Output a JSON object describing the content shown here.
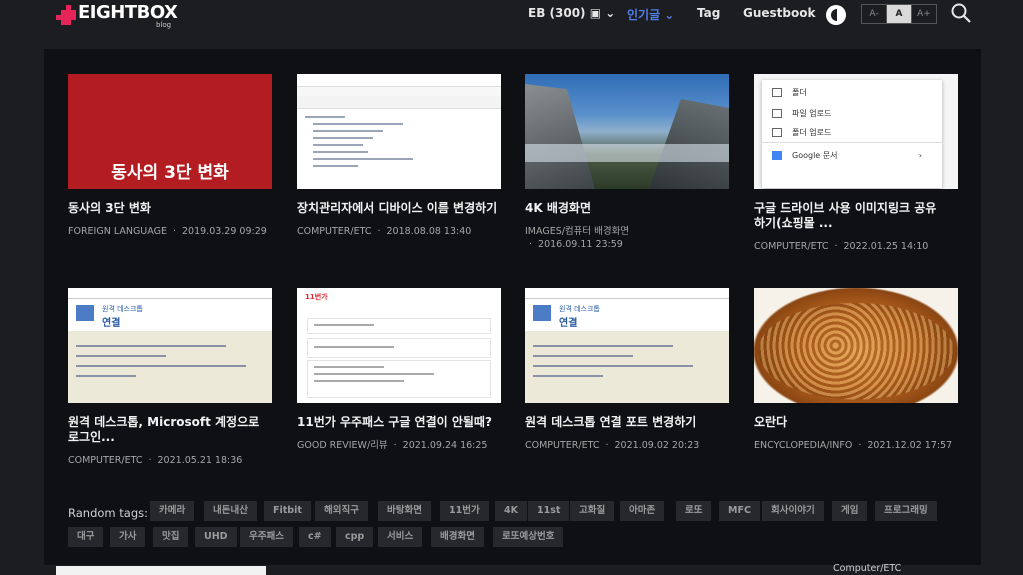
{
  "header": {
    "logo_text": "EIGHTBOX",
    "logo_sub": "blog",
    "nav": {
      "eb": "EB (300) ▣ ⌄",
      "popular": "인기글 ⌄",
      "tag": "Tag",
      "guestbook": "Guestbook"
    },
    "font_sizes": [
      "A-",
      "A",
      "A+"
    ],
    "active_font_index": 1,
    "accent_color": "#4f7fe8",
    "brand_color": "#e5245a"
  },
  "posts": [
    {
      "title": "동사의 3단 변화",
      "category": "FOREIGN LANGUAGE",
      "date": "2019.03.29 09:29",
      "thumb_text": "동사의 3단 변화"
    },
    {
      "title": "장치관리자에서 디바이스 이름 변경하기",
      "category": "COMPUTER/ETC",
      "date": "2018.08.08 13:40"
    },
    {
      "title": "4K 배경화면",
      "category": "IMAGES/컴퓨터 배경화면",
      "date": "2016.09.11 23:59"
    },
    {
      "title": "구글 드라이브 사용 이미지링크 공유 하기(쇼핑몰 ...",
      "category": "COMPUTER/ETC",
      "date": "2022.01.25 14:10",
      "thumb_items": [
        "폴더",
        "파일 업로드",
        "폴더 업로드",
        "Google 문서"
      ]
    },
    {
      "title": "원격 데스크톱, Microsoft 계정으로 로그인...",
      "category": "COMPUTER/ETC",
      "date": "2021.05.21 18:36",
      "thumb_head": [
        "원격 데스크톱",
        "연결"
      ]
    },
    {
      "title": "11번가 우주패스 구글 연결이 안될때?",
      "category": "GOOD REVIEW/리뷰",
      "date": "2021.09.24 16:25",
      "thumb_logo": "11번가"
    },
    {
      "title": "원격 데스크톱 연결 포트 변경하기",
      "category": "COMPUTER/ETC",
      "date": "2021.09.02 20:23",
      "thumb_head": [
        "원격 데스크톱",
        "연결"
      ]
    },
    {
      "title": "오란다",
      "category": "ENCYCLOPEDIA/INFO",
      "date": "2021.12.02 17:57"
    }
  ],
  "tags": {
    "label": "Random tags:",
    "items": [
      "카메라",
      "내돈내산",
      "Fitbit",
      "해외직구",
      "바탕화면",
      "11번가",
      "4K",
      "11st",
      "고화질",
      "아마존",
      "로또",
      "MFC",
      "회사이야기",
      "게임",
      "프로그래밍",
      "대구",
      "가사",
      "맛집",
      "UHD",
      "우주패스",
      "c#",
      "cpp",
      "서비스",
      "배경화면",
      "로또예상번호"
    ]
  },
  "bottom": {
    "category": "Computer/ETC"
  }
}
